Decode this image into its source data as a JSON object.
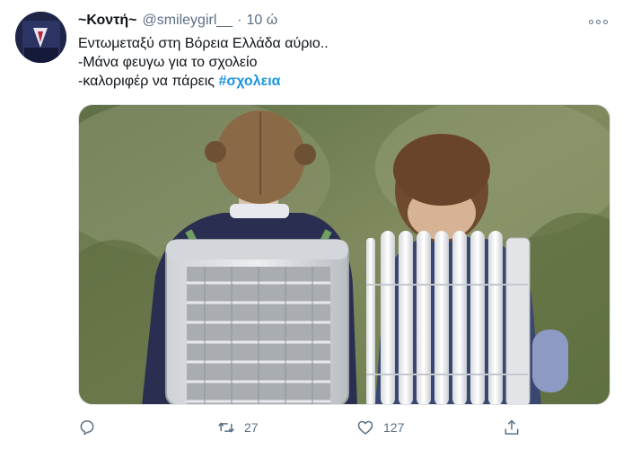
{
  "tweet": {
    "display_name": "~Κοντή~",
    "handle": "@smileygirl__",
    "separator": "·",
    "time": "10 ώ",
    "text_lines": [
      "Εντωμεταξύ στη Βόρεια Ελλάδα αύριο..",
      "-Μάνα φευγω για το σχολείο",
      "-καλοριφέρ να πάρεις "
    ],
    "hashtag": "#σχολεια"
  },
  "actions": {
    "reply_icon": "reply-icon",
    "retweet_icon": "retweet-icon",
    "retweet_count": "27",
    "like_icon": "heart-icon",
    "like_count": "127",
    "share_icon": "share-icon"
  },
  "colors": {
    "text": "#0f1419",
    "muted": "#5b7083",
    "link": "#1b95e0"
  }
}
